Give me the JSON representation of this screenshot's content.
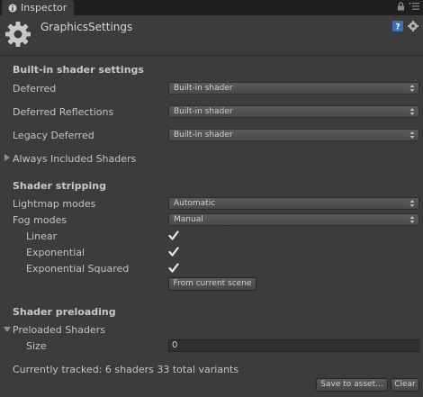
{
  "tab": {
    "label": "Inspector"
  },
  "header": {
    "title": "GraphicsSettings"
  },
  "builtin": {
    "heading": "Built-in shader settings",
    "rows": [
      {
        "label": "Deferred",
        "value": "Built-in shader"
      },
      {
        "label": "Deferred Reflections",
        "value": "Built-in shader"
      },
      {
        "label": "Legacy Deferred",
        "value": "Built-in shader"
      }
    ],
    "always_included": "Always Included Shaders"
  },
  "stripping": {
    "heading": "Shader stripping",
    "lightmap": {
      "label": "Lightmap modes",
      "value": "Automatic"
    },
    "fog": {
      "label": "Fog modes",
      "value": "Manual"
    },
    "fog_options": [
      {
        "label": "Linear",
        "checked": true
      },
      {
        "label": "Exponential",
        "checked": true
      },
      {
        "label": "Exponential Squared",
        "checked": true
      }
    ],
    "from_scene_button": "From current scene"
  },
  "preloading": {
    "heading": "Shader preloading",
    "preloaded": "Preloaded Shaders",
    "size_label": "Size",
    "size_value": "0",
    "tracked": "Currently tracked: 6 shaders 33 total variants",
    "save_button": "Save to asset...",
    "clear_button": "Clear"
  }
}
